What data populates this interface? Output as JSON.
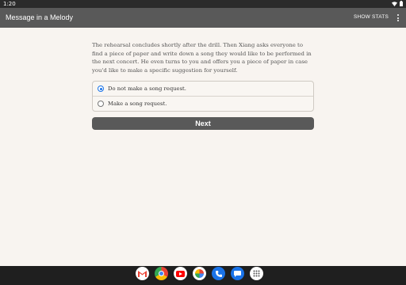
{
  "status_bar": {
    "time": "1:20"
  },
  "app_bar": {
    "title": "Message in a Melody",
    "show_stats_label": "SHOW STATS"
  },
  "passage": "The rehearsal concludes shortly after the drill. Then Xiang asks everyone to find a piece of paper and write down a song they would like to be performed in the next concert. He even turns to you and offers you a piece of paper in case you'd like to make a specific suggestion for yourself.",
  "choices": [
    {
      "label": "Do not make a song request.",
      "selected": true
    },
    {
      "label": "Make a song request.",
      "selected": false
    }
  ],
  "next_label": "Next",
  "dock": {
    "apps": [
      {
        "name": "gmail-icon",
        "glyph": "M"
      },
      {
        "name": "chrome-icon",
        "glyph": ""
      },
      {
        "name": "youtube-icon",
        "glyph": "▶"
      },
      {
        "name": "photos-icon",
        "glyph": ""
      },
      {
        "name": "phone-icon",
        "glyph": "✆"
      },
      {
        "name": "messages-icon",
        "glyph": "▬"
      },
      {
        "name": "app-drawer-icon",
        "glyph": "⋮⋮"
      }
    ]
  }
}
